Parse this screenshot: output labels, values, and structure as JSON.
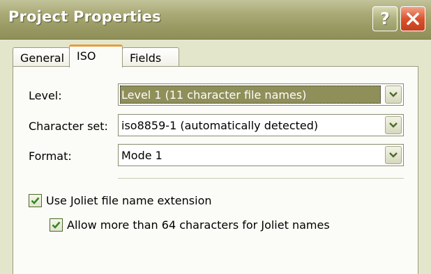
{
  "window": {
    "title": "Project Properties",
    "help_label": "?",
    "icons": {
      "help": "help-icon",
      "close": "close-icon"
    }
  },
  "tabs": [
    {
      "label": "General",
      "selected": false
    },
    {
      "label": "ISO",
      "selected": true
    },
    {
      "label": "Fields",
      "selected": false
    }
  ],
  "form": {
    "level": {
      "label": "Level:",
      "value": "Level 1 (11 character file names)"
    },
    "charset": {
      "label": "Character set:",
      "value": "iso8859-1 (automatically detected)"
    },
    "format": {
      "label": "Format:",
      "value": "Mode 1"
    }
  },
  "options": {
    "joliet": {
      "label": "Use Joliet file name extension",
      "checked": true
    },
    "joliet_long": {
      "label": "Allow more than 64 characters for Joliet names",
      "checked": true
    }
  },
  "colors": {
    "title_bar": "#999a63",
    "close_button": "#d9532f",
    "selected_tab_accent": "#e89b3c",
    "selection_highlight": "#8f8f5a",
    "check_mark": "#2f8a1f"
  }
}
